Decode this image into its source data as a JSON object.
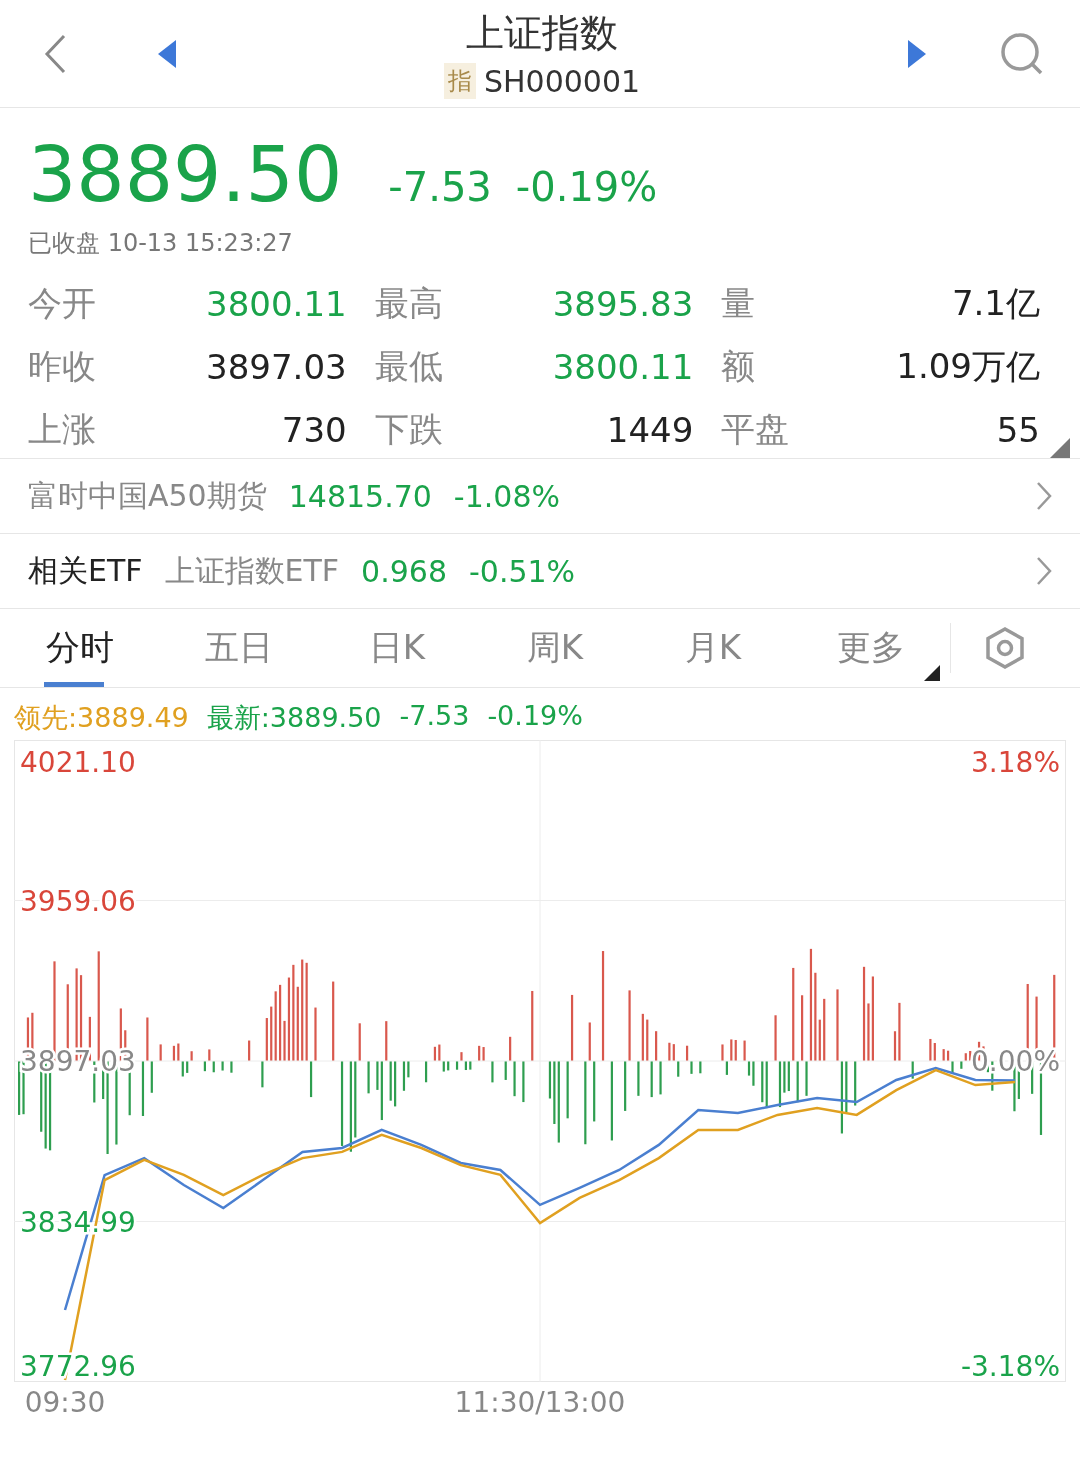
{
  "header": {
    "title": "上证指数",
    "badge": "指",
    "code": "SH000001"
  },
  "quote": {
    "price": "3889.50",
    "change": "-7.53",
    "percent": "-0.19%",
    "status": "已收盘 10-13 15:23:27"
  },
  "stats": [
    {
      "label": "今开",
      "value": "3800.11",
      "kind": "down"
    },
    {
      "label": "最高",
      "value": "3895.83",
      "kind": "down"
    },
    {
      "label": "量",
      "value": "7.1亿",
      "kind": "plain"
    },
    {
      "label": "昨收",
      "value": "3897.03",
      "kind": "plain"
    },
    {
      "label": "最低",
      "value": "3800.11",
      "kind": "down"
    },
    {
      "label": "额",
      "value": "1.09万亿",
      "kind": "plain"
    },
    {
      "label": "上涨",
      "value": "730",
      "kind": "plain"
    },
    {
      "label": "下跌",
      "value": "1449",
      "kind": "plain"
    },
    {
      "label": "平盘",
      "value": "55",
      "kind": "plain"
    }
  ],
  "related": [
    {
      "label": "富时中国A50期货",
      "value": "14815.70",
      "change": "-1.08%"
    },
    {
      "label": "相关ETF",
      "name": "上证指数ETF",
      "value": "0.968",
      "change": "-0.51%"
    }
  ],
  "tabs": [
    {
      "label": "分时",
      "selected": true
    },
    {
      "label": "五日",
      "selected": false
    },
    {
      "label": "日K",
      "selected": false
    },
    {
      "label": "周K",
      "selected": false
    },
    {
      "label": "月K",
      "selected": false
    },
    {
      "label": "更多",
      "selected": false
    }
  ],
  "legend": [
    {
      "text": "领先:3889.49",
      "color": "#e0a020"
    },
    {
      "text": "最新:3889.50",
      "color": "#1aa34a"
    },
    {
      "text": "-7.53",
      "color": "#1aa34a"
    },
    {
      "text": "-0.19%",
      "color": "#1aa34a"
    }
  ],
  "chart": {
    "chart_data": {
      "type": "line",
      "grid": true,
      "categories": [
        "09:30",
        null,
        null,
        null,
        null,
        null,
        null,
        null,
        null,
        null,
        null,
        null,
        "11:30/13:00",
        null,
        null,
        null,
        null,
        null,
        null,
        null,
        null,
        null,
        null,
        null,
        null
      ],
      "ylim": [
        3772.96,
        4021.1
      ],
      "yticks": [
        {
          "value": 4021.1,
          "label": "4021.10"
        },
        {
          "value": 3959.06,
          "label": "3959.06"
        },
        {
          "value": 3897.03,
          "label": "3897.03"
        },
        {
          "value": 3834.99,
          "label": "3834.99"
        },
        {
          "value": 3772.96,
          "label": "3772.96"
        }
      ],
      "series": [
        {
          "color": "#4a7fd0",
          "values": [
            3800.8,
            3852.9,
            3859.5,
            3849.1,
            3840.2,
            3851.0,
            3861.9,
            3863.4,
            3870.4,
            3864.6,
            3857.6,
            3854.9,
            3841.4,
            3848.0,
            3854.9,
            3864.6,
            3878.1,
            3876.9,
            3880.0,
            3882.7,
            3881.2,
            3889.7,
            3894.3,
            3889.7,
            3889.5
          ]
        },
        {
          "color": "#e0a020",
          "values": [
            3773.7,
            3851.0,
            3858.8,
            3853.0,
            3845.2,
            3853.0,
            3859.5,
            3861.9,
            3868.5,
            3863.4,
            3856.8,
            3853.0,
            3834.4,
            3844.1,
            3851.0,
            3859.5,
            3870.4,
            3870.4,
            3876.2,
            3878.9,
            3876.2,
            3885.8,
            3893.5,
            3887.7,
            3888.9
          ]
        }
      ]
    },
    "right_labels": [
      "3.18%",
      "0.00%",
      "-3.18%"
    ]
  }
}
